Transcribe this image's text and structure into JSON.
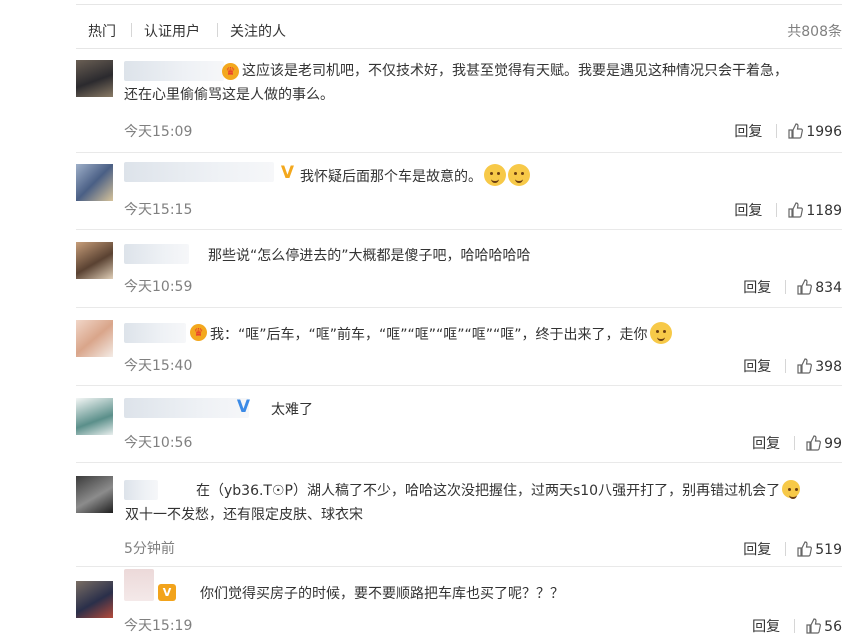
{
  "tabs": [
    "热门",
    "认证用户",
    "关注的人"
  ],
  "total": "共808条",
  "reply_label": "回复",
  "comments": [
    {
      "lines": [
        "这应该是老司机吧，不仅技术好，我甚至觉得有天赋。我要是遇见这种情况只会干着急，",
        "还在心里偷偷骂这是人做的事么。"
      ],
      "badge": "crown-icon",
      "time": "今天15:09",
      "likes": "1996"
    },
    {
      "lines": [
        "我怀疑后面那个车是故意的。"
      ],
      "badge": "yellow-v-icon",
      "time": "今天15:15",
      "likes": "1189"
    },
    {
      "lines": [
        "那些说“怎么停进去的”大概都是傻子吧，哈哈哈哈哈"
      ],
      "badge": "",
      "time": "今天10:59",
      "likes": "834"
    },
    {
      "lines": [
        "我：“哐”后车，“哐”前车，“哐”“哐”“哐”“哐”“哐”，终于出来了，走你"
      ],
      "badge": "crown-icon",
      "time": "今天15:40",
      "likes": "398"
    },
    {
      "lines": [
        "太难了"
      ],
      "badge": "blue-v-icon",
      "time": "今天10:56",
      "likes": "99"
    },
    {
      "lines": [
        "在（yb36.T☉P）湖人稿了不少，哈哈这次没把握住，过两天s10八强开打了，别再错过机会了",
        "双十一不发愁，还有限定皮肤、球衣宋"
      ],
      "badge": "",
      "time": "5分钟前",
      "likes": "519"
    },
    {
      "lines": [
        "你们觉得买房子的时候，要不要顺路把车库也买了呢？？？"
      ],
      "badge": "red-v-icon",
      "time": "今天15:19",
      "likes": "56"
    }
  ],
  "colors": {
    "text": "#333333",
    "muted": "#808080",
    "divider": "#e9e9e9",
    "badge_gold": "#f3a81e",
    "badge_blue": "#3b8ae6"
  }
}
